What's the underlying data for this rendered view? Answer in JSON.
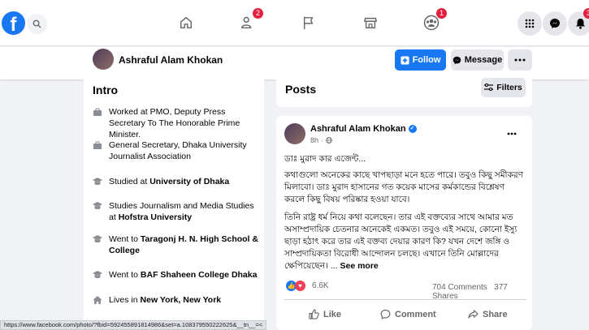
{
  "nav": {
    "logo": "f",
    "friends_badge": "2",
    "groups_badge": "1",
    "notifications_badge": "3"
  },
  "profile_bar": {
    "name": "Ashraful Alam Khokan",
    "follow_label": "Follow",
    "message_label": "Message"
  },
  "intro": {
    "title": "Intro",
    "items": [
      {
        "icon": "briefcase-icon",
        "text": "Worked at PMO, Deputy Press Secretary To The Honorable Prime Minister.",
        "bold": ""
      },
      {
        "icon": "briefcase-icon",
        "text": "General Secretary, Dhaka University Journalist Association",
        "bold": ""
      },
      {
        "icon": "graduation-cap-icon",
        "text": "Studied at ",
        "bold": "University of Dhaka"
      },
      {
        "icon": "graduation-cap-icon",
        "text": "Studies Journalism and Media Studies at ",
        "bold": "Hofstra University"
      },
      {
        "icon": "graduation-cap-icon",
        "text": "Went to ",
        "bold": "Taragonj H. N. High School & College"
      },
      {
        "icon": "graduation-cap-icon",
        "text": "Went to ",
        "bold": "BAF Shaheen College Dhaka"
      },
      {
        "icon": "home-icon",
        "text": "Lives in ",
        "bold": "New York, New York"
      }
    ]
  },
  "posts_header": {
    "title": "Posts",
    "filters_label": "Filters"
  },
  "post": {
    "author": "Ashraful Alam Khokan",
    "time": "8h",
    "paragraph1": "ডাঃ মুরাদ কার এজেন্ট...",
    "paragraph2": "কথাগুলো অনেকের কাছে খাপছাড়া মনে হতে পারে। তবুও কিছু সমীকরণ মিলাবো। ডাঃ মুরাদ হাসানের গত কয়েক মাসের কর্মকান্ডের বিশ্লেষণ করলে কিছু বিষয় পরিষ্কার হওয়া যাবে।",
    "paragraph3": "তিনি রাষ্ট্র ধর্ম নিয়ে কথা বলেছেন। তার এই বক্তব্যের সাথে আমার মত অসাম্প্রদায়িক চেতনার অনেকেই একমত। তবুও এই সময়ে, কোনো ইস্যু ছাড়া হঠাৎ করে তার এই বক্তব্য দেয়ার কারণ কি? যখন দেশে জঙ্গি ও সাম্প্রদায়িকতা বিরোধী আন্দোলন চলছে। এখানে তিনি মোল্লাদের ক্ষেপিয়েছেন। ...",
    "see_more": "See more",
    "reaction_count": "6.6K",
    "comments": "704 Comments",
    "shares": "377 Shares",
    "like_label": "Like",
    "comment_label": "Comment",
    "share_label": "Share"
  },
  "status_url": "https://www.facebook.com/photo/?fbid=592455891814986&set=a.108379550222625&__tn__=<",
  "colors": {
    "brand": "#1877f2",
    "badge": "#e41e3f",
    "background": "#f0f2f5"
  }
}
